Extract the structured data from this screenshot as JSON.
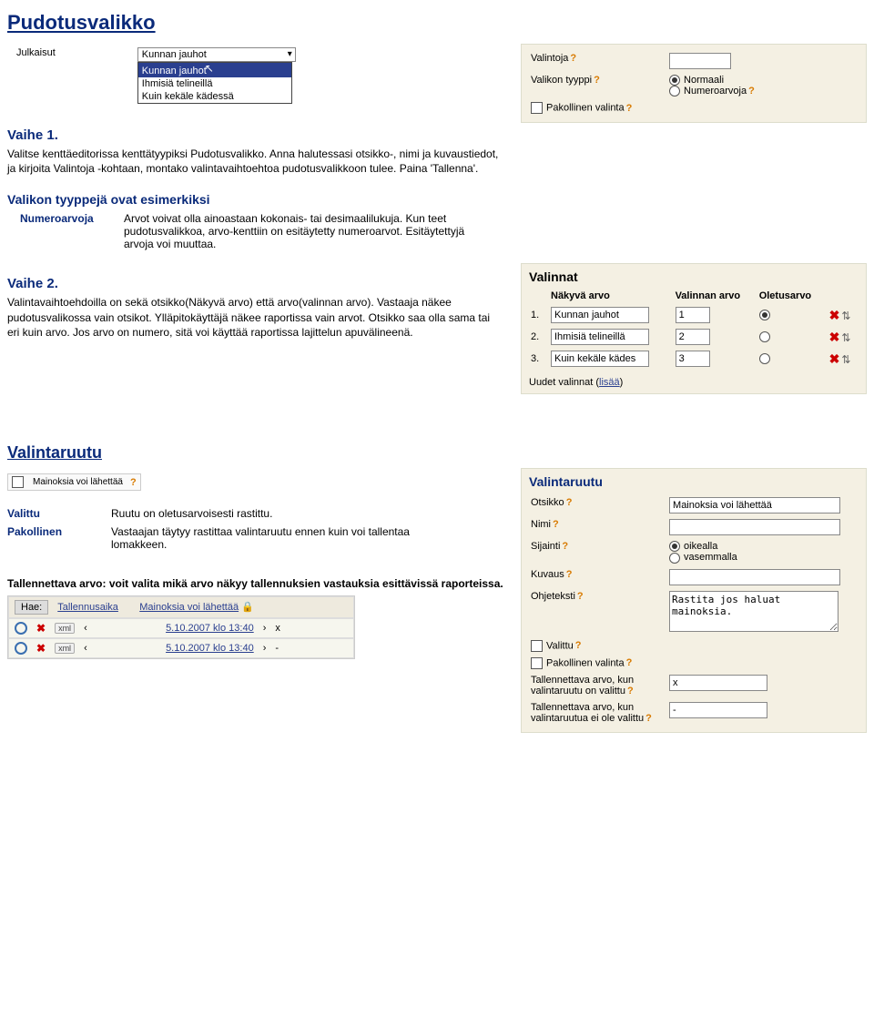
{
  "main_heading": "Pudotusvalikko",
  "section1": {
    "julkaisut_label": "Julkaisut",
    "dd_selected": "Kunnan jauhot",
    "dd_options": [
      "Kunnan jauhot",
      "Ihmisiä telineillä",
      "Kuin kekäle kädessä"
    ],
    "vaihe1_title": "Vaihe 1.",
    "vaihe1_text": "Valitse kenttäeditorissa kenttätyypiksi Pudotusvalikko. Anna halutessasi otsikko-, nimi ja kuvaustiedot, ja kirjoita Valintoja -kohtaan, montako valintavaihtoehtoa pudotusvalikkoon tulee. Paina 'Tallenna'.",
    "props": {
      "valintoja_label": "Valintoja",
      "type_label": "Valikon tyyppi",
      "type_opt1": "Normaali",
      "type_opt2": "Numeroarvoja",
      "pakollinen_label": "Pakollinen valinta"
    }
  },
  "types": {
    "intro": "Valikon tyyppejä ovat esimerkiksi",
    "num_term": "Numeroarvoja",
    "num_def": "Arvot voivat olla ainoastaan kokonais- tai desimaalilukuja. Kun teet pudotusvalikkoa, arvo-kenttiin on esitäytetty numeroarvot. Esitäytettyjä arvoja voi muuttaa."
  },
  "vaihe2": {
    "title": "Vaihe 2.",
    "text": "Valintavaihtoehdoilla on sekä otsikko(Näkyvä arvo) että arvo(valinnan arvo). Vastaaja näkee pudotusvalikossa vain otsikot. Ylläpitokäyttäjä näkee raportissa vain arvot. Otsikko saa olla sama tai eri kuin arvo. Jos arvo on numero, sitä voi käyttää raportissa lajittelun apuvälineenä.",
    "panel_title": "Valinnat",
    "col_label": "Näkyvä arvo",
    "col_value": "Valinnan arvo",
    "col_default": "Oletusarvo",
    "rows": [
      {
        "n": "1.",
        "label": "Kunnan jauhot",
        "value": "1",
        "def": true
      },
      {
        "n": "2.",
        "label": "Ihmisiä telineillä",
        "value": "2",
        "def": false
      },
      {
        "n": "3.",
        "label": "Kuin kekäle kädes",
        "value": "3",
        "def": false
      }
    ],
    "add_text": "Uudet valinnat (",
    "add_link": "lisää",
    "add_close": ")"
  },
  "valintaruutu": {
    "heading": "Valintaruutu",
    "mini_label": "Mainoksia voi lähettää",
    "valittu_term": "Valittu",
    "valittu_def": "Ruutu on oletusarvoisesti rastittu.",
    "pakollinen_term": "Pakollinen",
    "pakollinen_def": "Vastaajan täytyy rastittaa valintaruutu ennen kuin voi tallentaa lomakkeen.",
    "panel": {
      "title": "Valintaruutu",
      "otsikko_label": "Otsikko",
      "otsikko_value": "Mainoksia voi lähettää",
      "nimi_label": "Nimi",
      "nimi_value": "",
      "sijainti_label": "Sijainti",
      "sijainti_opt1": "oikealla",
      "sijainti_opt2": "vasemmalla",
      "kuvaus_label": "Kuvaus",
      "kuvaus_value": "",
      "ohje_label": "Ohjeteksti",
      "ohje_value": "Rastita jos haluat mainoksia.",
      "valittu_label": "Valittu",
      "pakollinen_label": "Pakollinen valinta",
      "tal_true_label": "Tallennettava arvo, kun valintaruutu on valittu",
      "tal_true_value": "x",
      "tal_false_label": "Tallennettava arvo, kun valintaruutua ei ole valittu",
      "tal_false_value": "-"
    }
  },
  "tal_arvo": {
    "intro": "Tallennettava arvo: voit valita mikä arvo näkyy tallennuksien vastauksia esittävissä raporteissa.",
    "hae": "Hae:",
    "col1": "Tallennusaika",
    "col2": "Mainoksia voi lähettää",
    "time": "5.10.2007 klo 13:40",
    "v1": "x",
    "v2": "-",
    "arrows": "‹  ›"
  }
}
